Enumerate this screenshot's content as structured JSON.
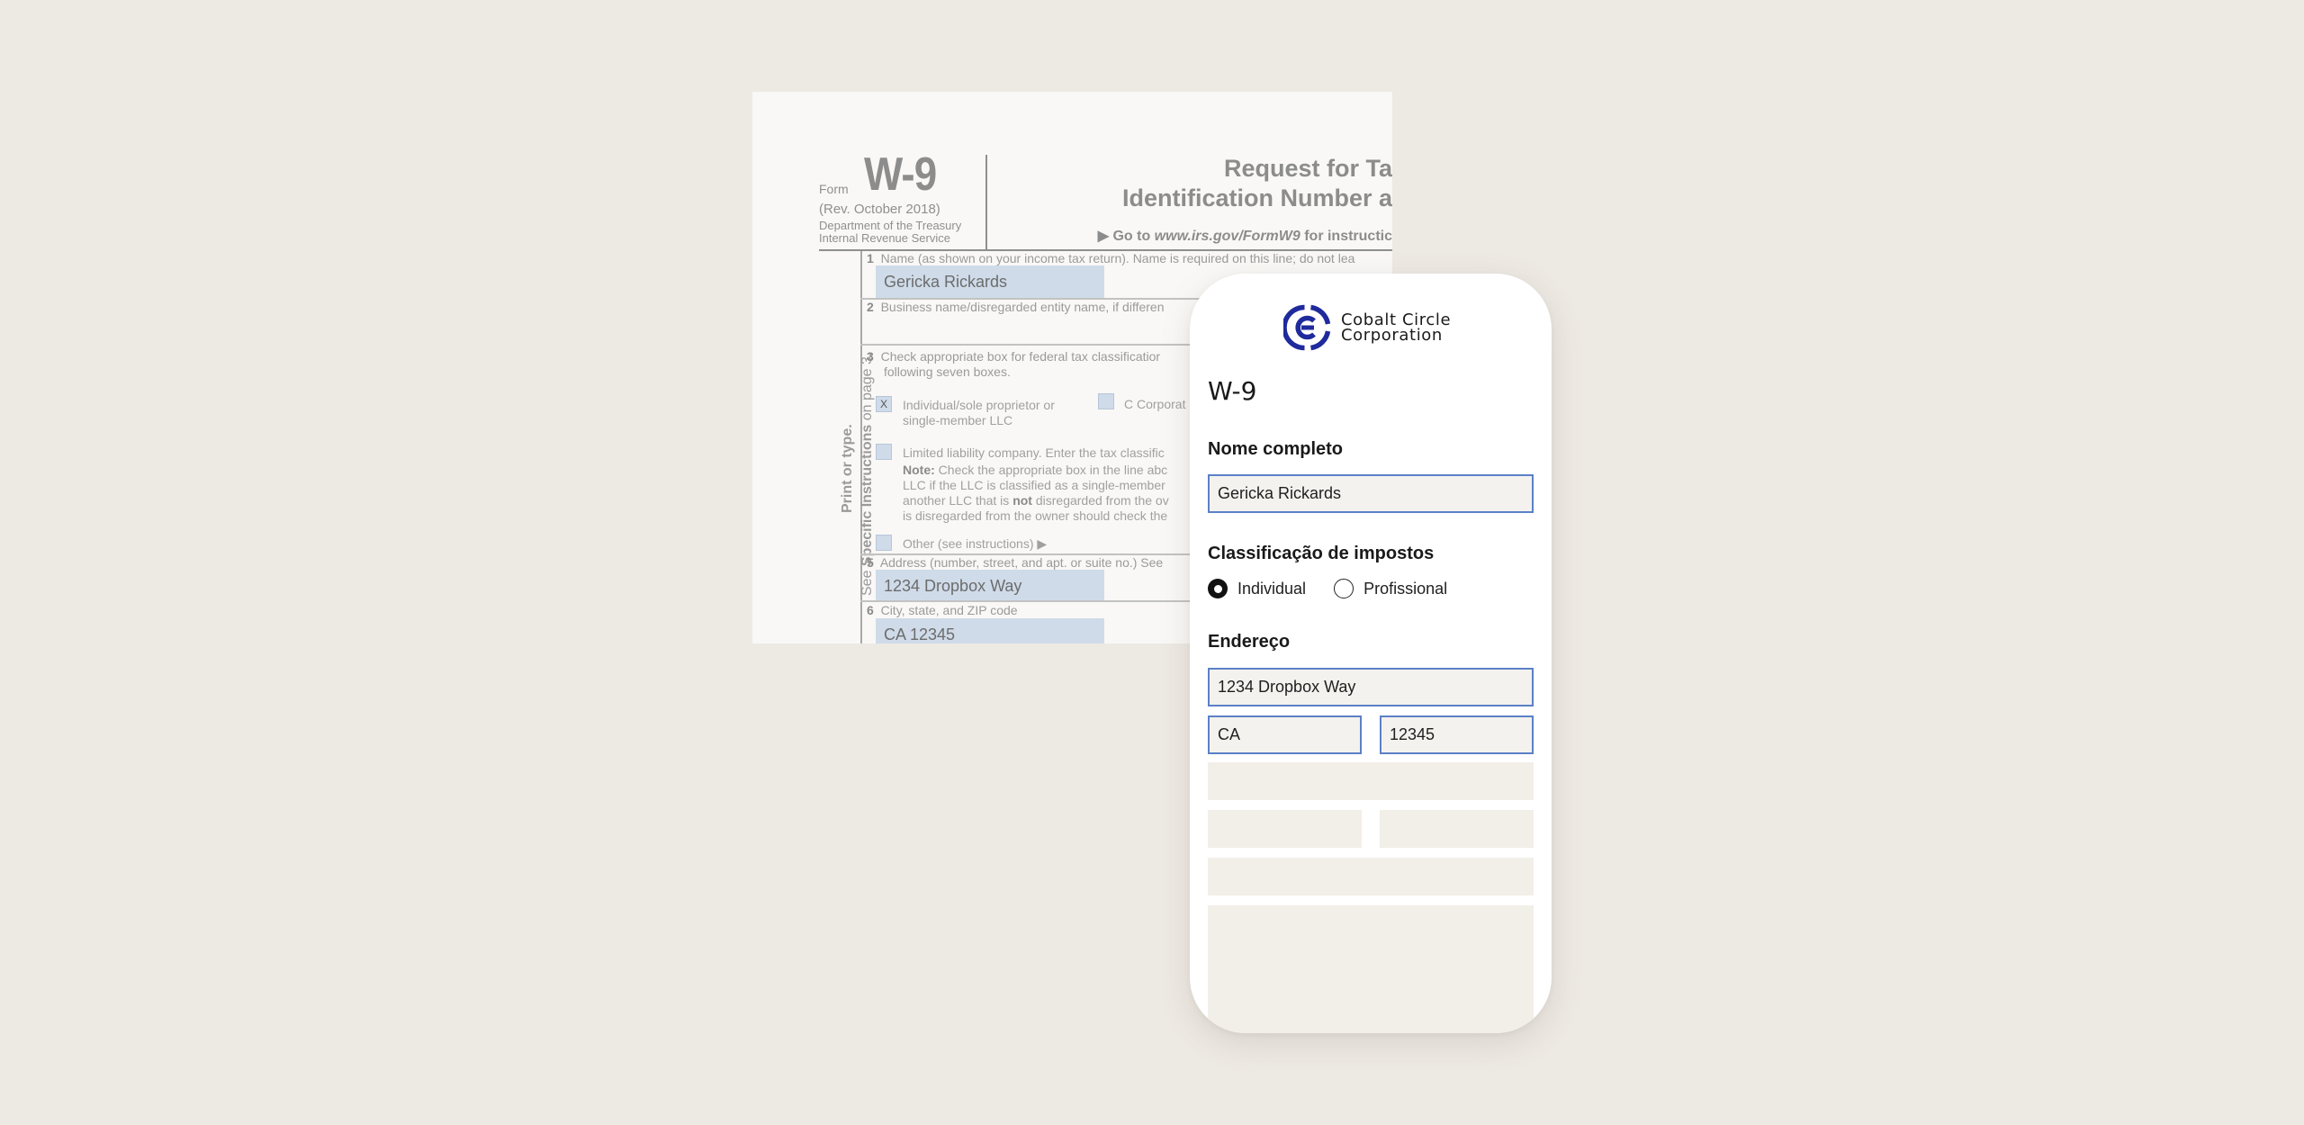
{
  "irs_form": {
    "form_word": "Form",
    "form_number": "W-9",
    "revision": "(Rev. October 2018)",
    "dept_line1": "Department of the Treasury",
    "dept_line2": "Internal Revenue Service",
    "title_line1": "Request for Ta",
    "title_line2": "Identification Number a",
    "goto_prefix": "▶ Go to ",
    "goto_url": "www.irs.gov/FormW9",
    "goto_suffix": " for instructic",
    "side_text_line1": "Print or type.",
    "side_text_line2_pre": "See ",
    "side_text_line2_bold": "Specific Instructions",
    "side_text_line2_post": " on page 3.",
    "line1": {
      "num": "1",
      "label": "Name (as shown on your income tax return). Name is required on this line; do not lea",
      "value": "Gericka Rickards"
    },
    "line2": {
      "num": "2",
      "label": "Business name/disregarded entity name, if differen"
    },
    "line3": {
      "num": "3",
      "label_l1": "Check appropriate box for federal tax classificatior",
      "label_l2": "following seven boxes.",
      "individual_mark": "X",
      "individual_l1": "Individual/sole proprietor or",
      "individual_l2": "single-member LLC",
      "c_corp": "C Corporat",
      "llc": "Limited liability company. Enter the tax classific",
      "note_bold": "Note:",
      "note_l1": " Check the appropriate box in the line abc",
      "note_l2": "LLC if the LLC is classified as a single-member",
      "note_l3_pre": "another LLC that is ",
      "note_l3_bold": "not",
      "note_l3_post": " disregarded from the ov",
      "note_l4": "is disregarded from the owner should check the",
      "other": "Other (see instructions) ▶"
    },
    "line5": {
      "num": "5",
      "label": "Address (number, street, and apt. or suite no.) See",
      "value": "1234 Dropbox Way"
    },
    "line6": {
      "num": "6",
      "label": "City, state, and ZIP code",
      "value": "CA 12345"
    }
  },
  "app": {
    "company_line1": "Cobalt Circle",
    "company_line2": "Corporation",
    "brand_color": "#1f2a9c",
    "document_title": "W-9",
    "full_name": {
      "label": "Nome completo",
      "value": "Gericka Rickards"
    },
    "tax_classification": {
      "label": "Classificação de impostos",
      "options": [
        {
          "label": "Individual",
          "selected": true
        },
        {
          "label": "Profissional",
          "selected": false
        }
      ]
    },
    "address": {
      "label": "Endereço",
      "street": "1234 Dropbox Way",
      "state": "CA",
      "zip": "12345"
    }
  }
}
